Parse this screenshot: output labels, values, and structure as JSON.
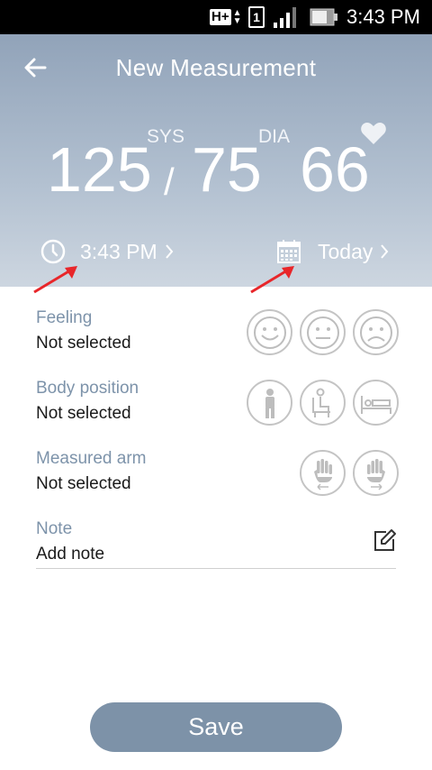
{
  "status_bar": {
    "network": "H+",
    "sim": "1",
    "time": "3:43 PM"
  },
  "header": {
    "title": "New Measurement",
    "sys_label": "SYS",
    "dia_label": "DIA",
    "sys_value": "125",
    "separator": "/",
    "dia_value": "75",
    "pulse_value": "66",
    "time": "3:43 PM",
    "date": "Today"
  },
  "feeling": {
    "title": "Feeling",
    "value": "Not selected",
    "options": [
      "happy-face-icon",
      "neutral-face-icon",
      "sad-face-icon"
    ]
  },
  "body_position": {
    "title": "Body position",
    "value": "Not selected",
    "options": [
      "standing-icon",
      "sitting-icon",
      "lying-icon"
    ]
  },
  "measured_arm": {
    "title": "Measured arm",
    "value": "Not selected",
    "options": [
      "left-hand-icon",
      "right-hand-icon"
    ]
  },
  "note": {
    "title": "Note",
    "value": "Add note"
  },
  "save_label": "Save",
  "colors": {
    "header_top": "#91a3b9",
    "header_bottom": "#cdd6e0",
    "label": "#7d93aa",
    "save_button": "#7d92a8",
    "annotation_arrow": "#e8262a"
  }
}
